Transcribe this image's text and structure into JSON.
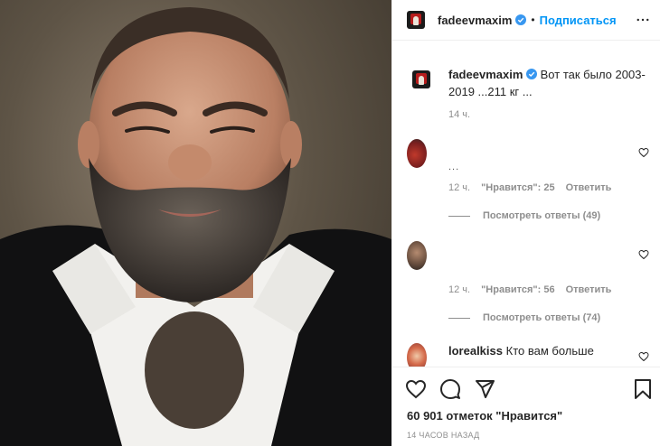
{
  "post": {
    "author": "fadeevmaxim",
    "follow_label": "Подписаться",
    "separator": "•"
  },
  "caption": {
    "username": "fadeevmaxim",
    "text": "Вот так было 2003-2019 ...211 кг ...",
    "time": "14 ч."
  },
  "comments": [
    {
      "username": "",
      "text": "...",
      "time": "12 ч.",
      "likes": "\"Нравится\": 25",
      "reply_label": "Ответить",
      "view_replies": "Посмотреть ответы (49)"
    },
    {
      "username": "",
      "text": "",
      "time": "12 ч.",
      "likes": "\"Нравится\": 56",
      "reply_label": "Ответить",
      "view_replies": "Посмотреть ответы (74)"
    },
    {
      "username": "lorealkiss",
      "text": "Кто вам больше",
      "time": "",
      "likes": "",
      "reply_label": "",
      "view_replies": ""
    }
  ],
  "footer": {
    "likes": "60 901 отметок \"Нравится\"",
    "post_time": "14 ЧАСОВ НАЗАД"
  },
  "colors": {
    "accent": "#0095f6",
    "verified": "#3897f0",
    "text": "#262626",
    "muted": "#8e8e8e"
  },
  "icons": {
    "heart": "heart-icon",
    "comment": "comment-icon",
    "share": "share-icon",
    "save": "bookmark-icon",
    "more": "more-horizontal-icon",
    "verified": "verified-badge-icon"
  }
}
